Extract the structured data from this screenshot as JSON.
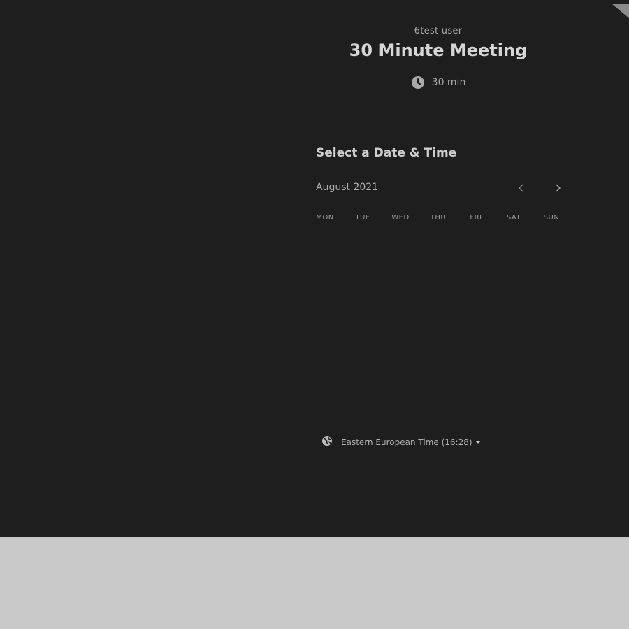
{
  "event": {
    "host": "6test user",
    "title": "30 Minute Meeting",
    "duration": "30 min",
    "duration_icon": "clock-icon"
  },
  "calendar": {
    "heading": "Select a Date & Time",
    "month_label": "August 2021",
    "prev_icon": "chevron-left-icon",
    "next_icon": "chevron-right-icon",
    "weekdays": [
      "MON",
      "TUE",
      "WED",
      "THU",
      "FRI",
      "SAT",
      "SUN"
    ]
  },
  "timezone": {
    "icon": "globe-icon",
    "label": "Eastern European Time (16:28)"
  },
  "colors": {
    "panel_bg": "#1e1e1e",
    "page_bg": "#c9c9c9"
  }
}
